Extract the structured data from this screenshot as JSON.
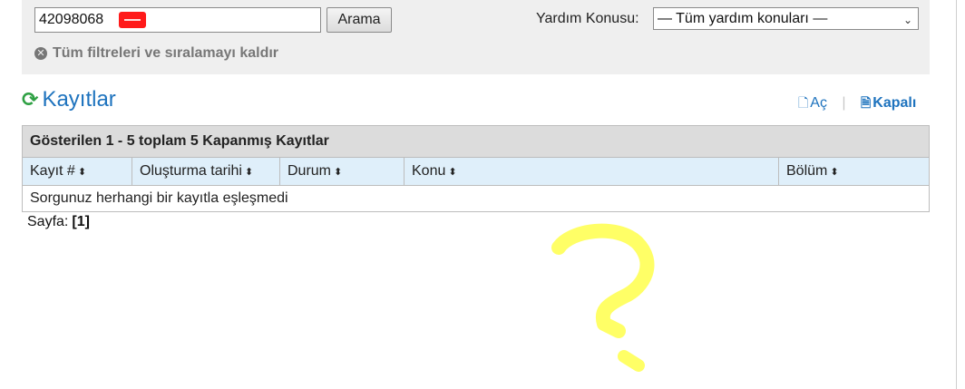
{
  "search": {
    "value": "42098068",
    "button_label": "Arama",
    "topic_label": "Yardım Konusu:",
    "topic_selected": "— Tüm yardım konuları —",
    "clear_filters_label": "Tüm filtreleri ve sıralamayı kaldır"
  },
  "tickets": {
    "title": "Kayıtlar",
    "status_open": "Aç",
    "status_closed": "Kapalı",
    "table_caption": "Gösterilen 1 - 5 toplam 5 Kapanmış Kayıtlar",
    "columns": [
      "Kayıt #",
      "Oluşturma tarihi",
      "Durum",
      "Konu",
      "Bölüm"
    ],
    "empty_message": "Sorgunuz herhangi bir kayıtla eşleşmedi"
  },
  "pagination": {
    "label": "Sayfa:",
    "current": "[1]"
  },
  "icons": {
    "refresh": "refresh-icon",
    "clear": "circle-x-icon",
    "document": "document-icon",
    "sort": "sort-icon",
    "dropdown": "chevron-down-icon"
  },
  "colors": {
    "link": "#1e73be",
    "refresh": "#2ea043",
    "redaction": "#ff1a1a",
    "annotation": "#ffff66",
    "header_row": "#dfeffa",
    "caption_row": "#dcdcdc"
  }
}
